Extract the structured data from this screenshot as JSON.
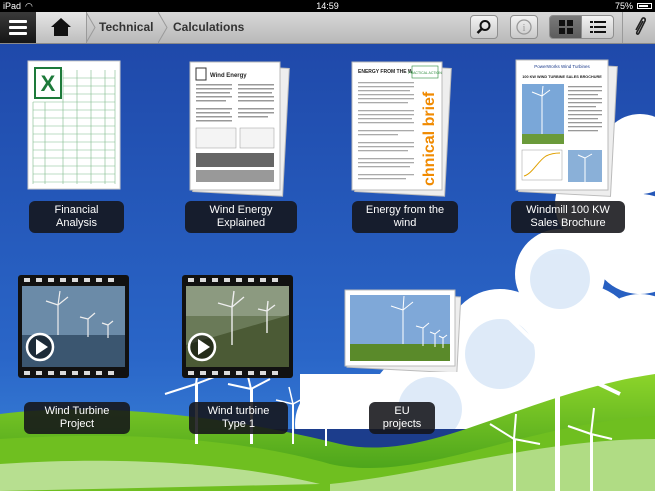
{
  "status_bar": {
    "device": "iPad",
    "time": "14:59",
    "battery": "75%"
  },
  "toolbar": {
    "breadcrumbs": [
      "Technical",
      "Calculations"
    ]
  },
  "items": [
    {
      "label": "Financial Analysis",
      "kind": "spreadsheet"
    },
    {
      "label": "Wind Energy Explained",
      "kind": "pdf"
    },
    {
      "label": "Energy from the wind",
      "kind": "pdf"
    },
    {
      "label": "Windmill 100 KW Sales Brochure",
      "kind": "pdf"
    },
    {
      "label": "Wind Turbine Project",
      "kind": "video"
    },
    {
      "label": "Wind turbine Type 1",
      "kind": "video"
    },
    {
      "label": "EU projects",
      "kind": "photos"
    }
  ],
  "thumb_text": {
    "wind_energy_title": "Wind Energy",
    "energy_wind_title": "ENERGY FROM THE WIND",
    "practical_action": "PRACTICAL ACTION",
    "technical_brief": "chnical brief",
    "powerworks_brand": "PowerWorks Wind Turbines",
    "sales_heading": "100 KW WIND TURBINE SALES BROCHURE"
  },
  "colors": {
    "accent_excel": "#1d7a3a",
    "orange": "#f08a00",
    "sky": "#1e4fb0"
  }
}
